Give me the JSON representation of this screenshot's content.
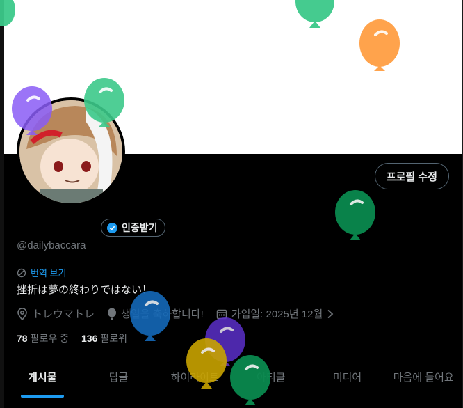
{
  "profile": {
    "edit_label": "프로필 수정",
    "verify_label": "인증받기",
    "handle": "@dailybaccara",
    "translate_label": "번역 보기",
    "bio": "挫折は夢の終わりではない！",
    "location": "トレウマトレ",
    "birthday_text": "생일을 축하합니다!",
    "joined": "가입일: 2025년 12월",
    "following_count": "78",
    "following_label": "팔로우 중",
    "followers_count": "136",
    "followers_label": "팔로워"
  },
  "tabs": [
    {
      "label": "게시물"
    },
    {
      "label": "답글"
    },
    {
      "label": "하이라이트"
    },
    {
      "label": "아티클"
    },
    {
      "label": "미디어"
    },
    {
      "label": "마음에 들어요"
    }
  ],
  "colors": {
    "accent": "#1d9bf0",
    "balloon_green": "#3cc98a",
    "balloon_orange": "#ff9f43",
    "balloon_purple": "#8a5cf6",
    "balloon_darkgreen": "#0a8a4f",
    "balloon_blue": "#1469b8",
    "balloon_yellow": "#c9a400",
    "balloon_violet": "#5b2fc9"
  }
}
